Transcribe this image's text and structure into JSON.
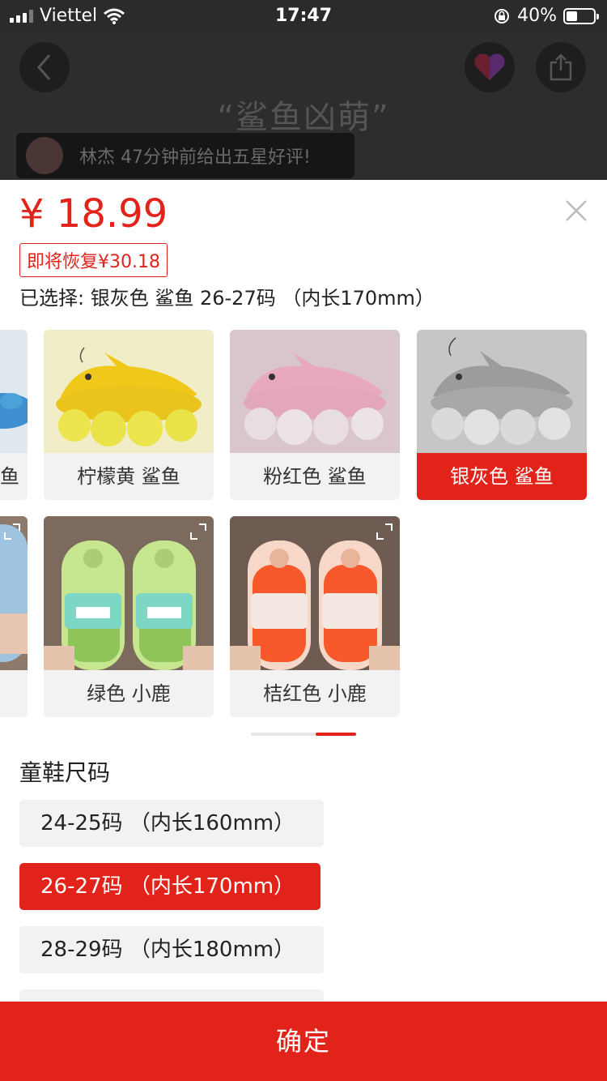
{
  "status_bar": {
    "carrier": "Viettel",
    "time": "17:47",
    "battery": "40%",
    "battery_level": 0.4
  },
  "product_header": {
    "hero_text": "“鲨鱼凶萌”",
    "review_text": "林杰 47分钟前给出五星好评!"
  },
  "sheet": {
    "price": "¥ 18.99",
    "restore_badge": "即将恢复¥30.18",
    "selected_text": "已选择: 银灰色 鲨鱼 26-27码 （内长170mm）",
    "variants": [
      {
        "label": "鱼",
        "color": "#a9c3d6"
      },
      {
        "label": "柠檬黄 鲨鱼",
        "color": "#f2d21c"
      },
      {
        "label": "粉红色 鲨鱼",
        "color": "#e6bccb"
      },
      {
        "label": "银灰色 鲨鱼",
        "color": "#bcbcbc"
      },
      {
        "label": "",
        "color": "#9fc4df"
      },
      {
        "label": "绿色 小鹿",
        "color": "#a6d564"
      },
      {
        "label": "桔红色 小鹿",
        "color": "#f7592a"
      }
    ],
    "selected_variant": "银灰色 鲨鱼",
    "size_title": "童鞋尺码",
    "sizes": [
      "24-25码 （内长160mm）",
      "26-27码 （内长170mm）",
      "28-29码 （内长180mm）"
    ],
    "selected_size": "26-27码 （内长170mm）",
    "confirm_label": "确定"
  },
  "colors": {
    "accent": "#e2231a",
    "card_bg": "#f2f2f2"
  }
}
